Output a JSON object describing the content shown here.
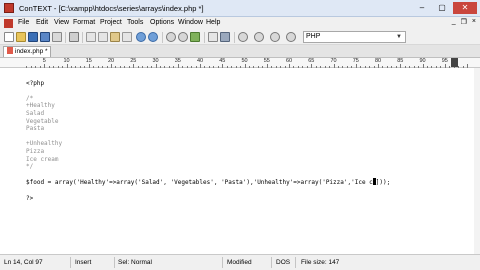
{
  "window": {
    "title": "ConTEXT - [C:\\xampp\\htdocs\\series\\arrays\\index.php *]",
    "controls": {
      "minimize": "–",
      "maximize": "▢",
      "close": "✕"
    }
  },
  "menu": {
    "items": [
      "File",
      "Edit",
      "View",
      "Format",
      "Project",
      "Tools",
      "Options",
      "Window",
      "Help"
    ],
    "mdi_controls": {
      "minimize": "_",
      "restore": "❐",
      "close": "×"
    }
  },
  "toolbar": {
    "highlighter": "PHP",
    "icons": [
      "new-file-icon",
      "open-icon",
      "save-icon",
      "save-all-icon",
      "close-file-icon",
      "print-icon",
      "cut-icon",
      "copy-icon",
      "paste-icon",
      "delete-icon",
      "undo-icon",
      "redo-icon",
      "find-icon",
      "find-next-icon",
      "replace-icon",
      "word-wrap-icon",
      "settings-icon",
      "run-icon-1",
      "run-icon-2",
      "run-icon-3",
      "run-icon-4"
    ]
  },
  "tabs": [
    {
      "label": "index.php *",
      "active": true
    }
  ],
  "ruler": {
    "labels": [
      "5",
      "10",
      "15",
      "20",
      "25",
      "30",
      "35",
      "40",
      "45",
      "50",
      "55",
      "60",
      "65",
      "70",
      "75",
      "80",
      "85",
      "90",
      "95"
    ],
    "cursor_col": "97"
  },
  "editor": {
    "lines": [
      "<?php",
      "",
      "/*",
      "+Healthy",
      "Salad",
      "Vegetable",
      "Pasta",
      "",
      "+Unhealthy",
      "Pizza",
      "Ice cream",
      "*/",
      "",
      "$food = array('Healthy'=>array('Salad', 'Vegetables', 'Pasta'),'Unhealthy'=>array('Pizza','Ice c",
      "",
      "?>"
    ],
    "line14_tail": "]));"
  },
  "status": {
    "position": "Ln 14, Col 97",
    "mode": "Insert",
    "selection": "Sel: Normal",
    "modified": "Modified",
    "format": "DOS",
    "file_size": "File size: 147"
  },
  "colors": {
    "titlebar_bg": "#dfe8f5",
    "close_button": "#c9463d",
    "comment": "#909090"
  }
}
